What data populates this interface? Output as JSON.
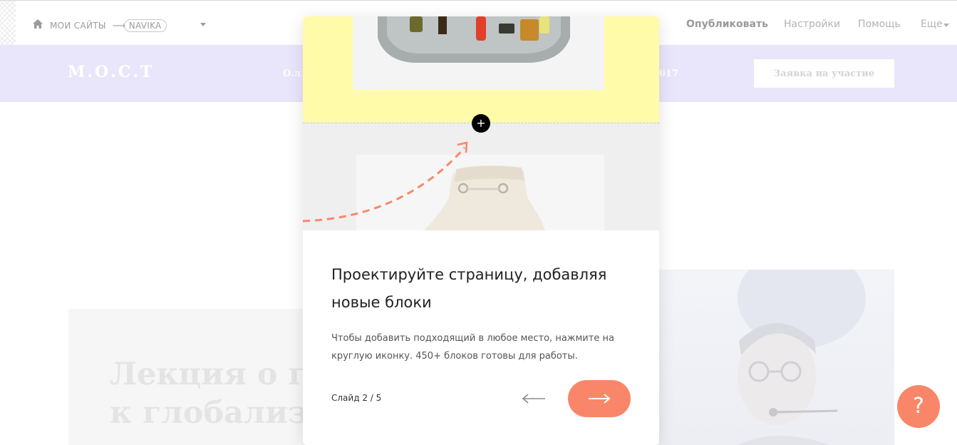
{
  "topbar": {
    "breadcrumb_home": "МОИ САЙТЫ",
    "breadcrumb_arrow": "⟶",
    "site_name": "NAVIKA",
    "nav_publish": "Опубликовать",
    "nav_settings": "Настройки",
    "nav_help": "Помощь",
    "nav_more": "Еще"
  },
  "site_header": {
    "logo": "М.О.С.Т",
    "text_left": "О.л",
    "text_right": "017",
    "apply_button": "Заявка на участие"
  },
  "page": {
    "lecture_title": "Лекция о г\nк глобализ"
  },
  "help_button": "?",
  "modal": {
    "add_block_symbol": "+",
    "title": "Проектируйте страницу, добавляя новые блоки",
    "description": "Чтобы добавить подходящий в любое место, нажмите на круглую иконку. 450+ блоков готовы для работы.",
    "slide_label": "Слайд 2 / 5",
    "prev_label": "previous slide",
    "next_label": "next slide"
  },
  "colors": {
    "accent": "#fa8669",
    "header_purple": "#e9e6fb",
    "illustration_yellow": "#fffba8",
    "illustration_gray": "#efefef"
  },
  "icons": {
    "home": "home-icon",
    "caret": "chevron-down-icon",
    "prev": "arrow-left-icon",
    "next": "arrow-right-icon",
    "add": "plus-icon",
    "help": "question-icon"
  }
}
